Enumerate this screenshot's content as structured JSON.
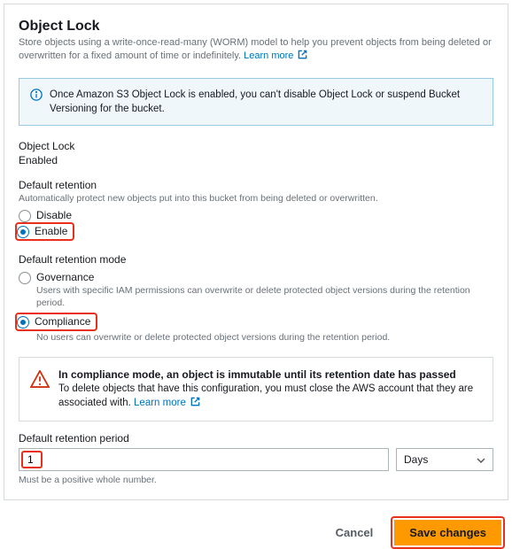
{
  "header": {
    "title": "Object Lock",
    "subtitle": "Store objects using a write-once-read-many (WORM) model to help you prevent objects from being deleted or overwritten for a fixed amount of time or indefinitely.",
    "learn_more": "Learn more"
  },
  "info_box": {
    "text": "Once Amazon S3 Object Lock is enabled, you can't disable Object Lock or suspend Bucket Versioning for the bucket."
  },
  "status": {
    "label": "Object Lock",
    "value": "Enabled"
  },
  "retention": {
    "label": "Default retention",
    "desc": "Automatically protect new objects put into this bucket from being deleted or overwritten.",
    "options": [
      {
        "label": "Disable",
        "checked": false
      },
      {
        "label": "Enable",
        "checked": true
      }
    ]
  },
  "mode": {
    "label": "Default retention mode",
    "options": [
      {
        "label": "Governance",
        "sub": "Users with specific IAM permissions can overwrite or delete protected object versions during the retention period.",
        "checked": false
      },
      {
        "label": "Compliance",
        "sub": "No users can overwrite or delete protected object versions during the retention period.",
        "checked": true
      }
    ]
  },
  "warning": {
    "title": "In compliance mode, an object is immutable until its retention date has passed",
    "body": "To delete objects that have this configuration, you must close the AWS account that they are associated with.",
    "learn_more": "Learn more"
  },
  "period": {
    "label": "Default retention period",
    "value": "1",
    "unit": "Days",
    "helper": "Must be a positive whole number."
  },
  "footer": {
    "cancel": "Cancel",
    "save": "Save changes"
  },
  "colors": {
    "accent": "#ff9900",
    "link": "#0073bb",
    "highlight": "#e8301c"
  }
}
